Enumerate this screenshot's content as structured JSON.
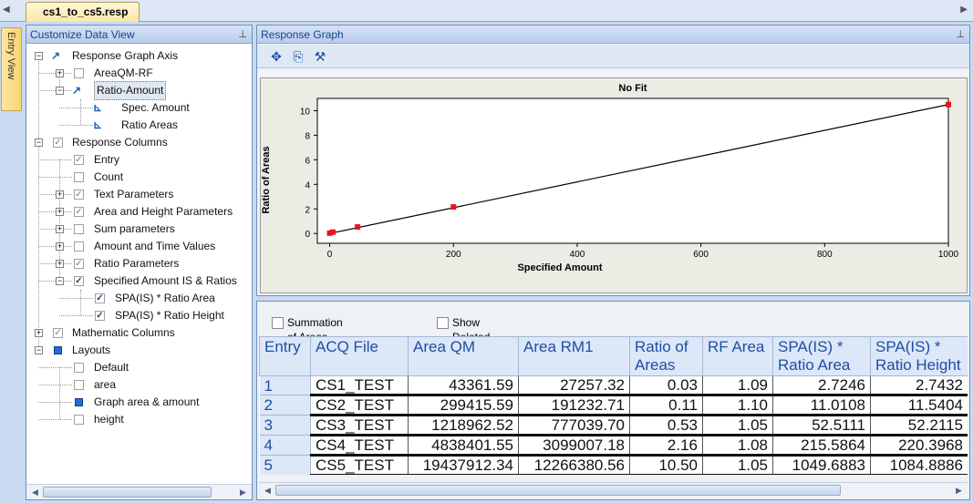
{
  "document_tab": {
    "title": "cs1_to_cs5.resp"
  },
  "side_tab": {
    "label": "Entry View"
  },
  "customize_panel": {
    "title": "Customize Data View",
    "tree": [
      {
        "label": "Response Graph Axis",
        "indent": 0,
        "expander": "minus",
        "marker": "graph-icon"
      },
      {
        "label": "AreaQM-RF",
        "indent": 1,
        "expander": "plus",
        "marker": "checkbox"
      },
      {
        "label": "Ratio-Amount",
        "indent": 1,
        "expander": "minus",
        "marker": "graph-icon",
        "selected": true
      },
      {
        "label": "Spec. Amount",
        "indent": 2,
        "expander": "",
        "marker": "axis-icon"
      },
      {
        "label": "Ratio Areas",
        "indent": 2,
        "expander": "",
        "marker": "axis-icon"
      },
      {
        "label": "Response Columns",
        "indent": 0,
        "expander": "minus",
        "marker": "check-gray"
      },
      {
        "label": "Entry",
        "indent": 1,
        "expander": "",
        "marker": "check-gray"
      },
      {
        "label": "Count",
        "indent": 1,
        "expander": "",
        "marker": "checkbox"
      },
      {
        "label": "Text Parameters",
        "indent": 1,
        "expander": "plus",
        "marker": "check-gray"
      },
      {
        "label": "Area and Height Parameters",
        "indent": 1,
        "expander": "plus",
        "marker": "check-gray"
      },
      {
        "label": "Sum parameters",
        "indent": 1,
        "expander": "plus",
        "marker": "checkbox"
      },
      {
        "label": "Amount and Time Values",
        "indent": 1,
        "expander": "plus",
        "marker": "checkbox"
      },
      {
        "label": "Ratio Parameters",
        "indent": 1,
        "expander": "plus",
        "marker": "check-gray"
      },
      {
        "label": "Specified Amount IS & Ratios",
        "indent": 1,
        "expander": "minus",
        "marker": "check-dark"
      },
      {
        "label": "SPA(IS) * Ratio Area",
        "indent": 2,
        "expander": "",
        "marker": "check-dark"
      },
      {
        "label": "SPA(IS) * Ratio Height",
        "indent": 2,
        "expander": "",
        "marker": "check-dark"
      },
      {
        "label": "Mathematic Columns",
        "indent": 0,
        "expander": "plus",
        "marker": "check-gray"
      },
      {
        "label": "Layouts",
        "indent": 0,
        "expander": "minus",
        "marker": "square"
      },
      {
        "label": "Default",
        "indent": 1,
        "expander": "",
        "marker": "checkbox"
      },
      {
        "label": "area",
        "indent": 1,
        "expander": "",
        "marker": "checkbox"
      },
      {
        "label": "Graph area & amount",
        "indent": 1,
        "expander": "",
        "marker": "square"
      },
      {
        "label": "height",
        "indent": 1,
        "expander": "",
        "marker": "checkbox"
      }
    ]
  },
  "graph_panel": {
    "title": "Response Graph",
    "toolbar": [
      {
        "name": "zoom-fit-icon",
        "glyph": "✥"
      },
      {
        "name": "copy-icon",
        "glyph": "⎘"
      },
      {
        "name": "tools-icon",
        "glyph": "⚒"
      }
    ]
  },
  "chart_data": {
    "type": "scatter",
    "title": "No Fit",
    "xlabel": "Specified Amount",
    "ylabel": "Ratio of Areas",
    "xlim": [
      -20,
      1000
    ],
    "ylim": [
      -0.8,
      11
    ],
    "xticks": [
      0,
      200,
      400,
      600,
      800,
      1000
    ],
    "yticks": [
      0,
      2,
      4,
      6,
      8,
      10
    ],
    "points": [
      {
        "x": 0,
        "y": 0.03
      },
      {
        "x": 5,
        "y": 0.11
      },
      {
        "x": 45,
        "y": 0.53
      },
      {
        "x": 200,
        "y": 2.16
      },
      {
        "x": 1000,
        "y": 10.5
      }
    ],
    "line": {
      "x": [
        0,
        1000
      ],
      "y": [
        0,
        10.5
      ]
    },
    "marker_color": "#e8141c",
    "line_color": "#000000"
  },
  "grid_panel": {
    "summation_label": "Summation of Areas",
    "show_deleted_label": "Show Deleted Entries",
    "columns": [
      {
        "label": "Entry",
        "width": 56
      },
      {
        "label": "ACQ File",
        "width": 107
      },
      {
        "label": "Area QM",
        "width": 121
      },
      {
        "label": "Area RM1",
        "width": 122
      },
      {
        "label": "Ratio of\nAreas",
        "width": 80
      },
      {
        "label": "RF Area",
        "width": 77
      },
      {
        "label": "SPA(IS) *\nRatio Area",
        "width": 107
      },
      {
        "label": "SPA(IS) *\nRatio Height",
        "width": 107
      }
    ],
    "rows": [
      [
        "1",
        "CS1_TEST",
        "43361.59",
        "27257.32",
        "0.03",
        "1.09",
        "2.7246",
        "2.7432"
      ],
      [
        "2",
        "CS2_TEST",
        "299415.59",
        "191232.71",
        "0.11",
        "1.10",
        "11.0108",
        "11.5404"
      ],
      [
        "3",
        "CS3_TEST",
        "1218962.52",
        "777039.70",
        "0.53",
        "1.05",
        "52.5111",
        "52.2115"
      ],
      [
        "4",
        "CS4_TEST",
        "4838401.55",
        "3099007.18",
        "2.16",
        "1.08",
        "215.5864",
        "220.3968"
      ],
      [
        "5",
        "CS5_TEST",
        "19437912.34",
        "12266380.56",
        "10.50",
        "1.05",
        "1049.6883",
        "1084.8886"
      ]
    ]
  }
}
